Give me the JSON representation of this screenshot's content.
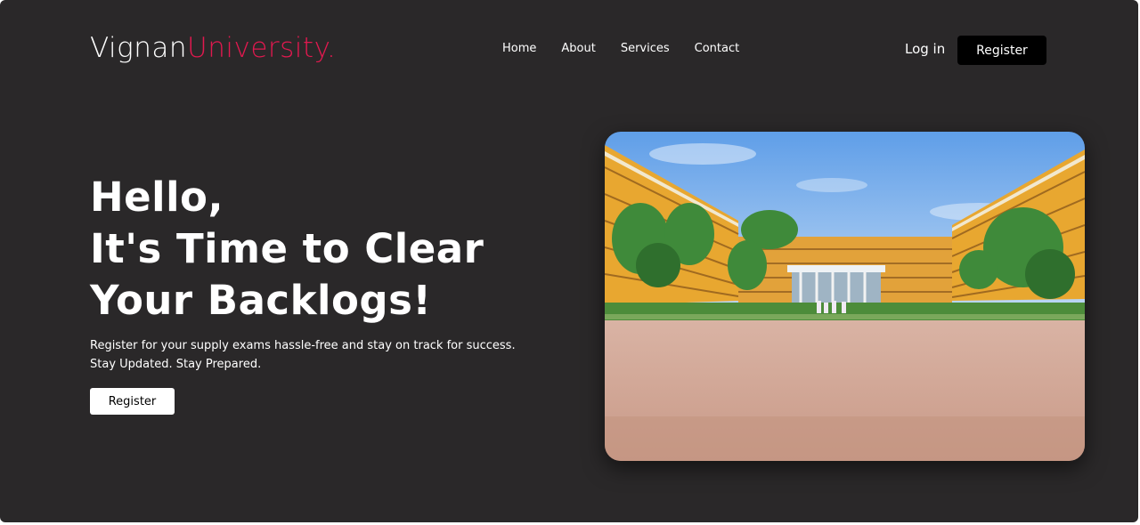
{
  "header": {
    "brand_main": "Vignan",
    "brand_accent": "University.",
    "nav": [
      "Home",
      "About",
      "Services",
      "Contact"
    ],
    "login_label": "Log in",
    "register_label": "Register"
  },
  "hero": {
    "title_lines": [
      "Hello,",
      "It's Time to Clear",
      "Your Backlogs!"
    ],
    "subtitle_lines": [
      "Register for your supply exams hassle-free and stay on track for success.",
      "Stay Updated. Stay Prepared."
    ],
    "register_label": "Register"
  },
  "colors": {
    "background": "#2a2829",
    "accent": "#e0194f"
  },
  "image": {
    "semantic": "campus-building-photo"
  }
}
